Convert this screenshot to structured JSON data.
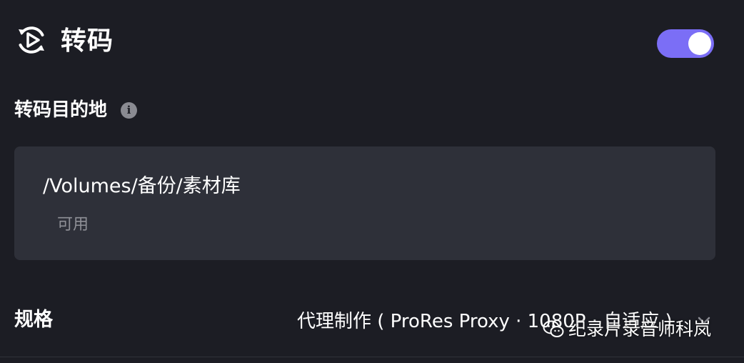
{
  "header": {
    "icon": "transcode-play-cycle-icon",
    "title": "转码",
    "toggle_on": true
  },
  "destination": {
    "label": "转码目的地",
    "info_icon": "info-icon",
    "info_glyph": "i",
    "path": "/Volumes/备份/素材库",
    "status": "可用"
  },
  "spec": {
    "label": "规格",
    "value": "代理制作 ( ProRes Proxy · 1080P · 自适应 )",
    "chevron": "chevron-down-icon"
  },
  "watermark": {
    "icon": "wechat-icon",
    "text": "纪录片录音师科岚"
  },
  "colors": {
    "background": "#1c1d24",
    "panel": "#2e3039",
    "accent": "#7b6ef6",
    "muted_text": "#8f9097"
  }
}
